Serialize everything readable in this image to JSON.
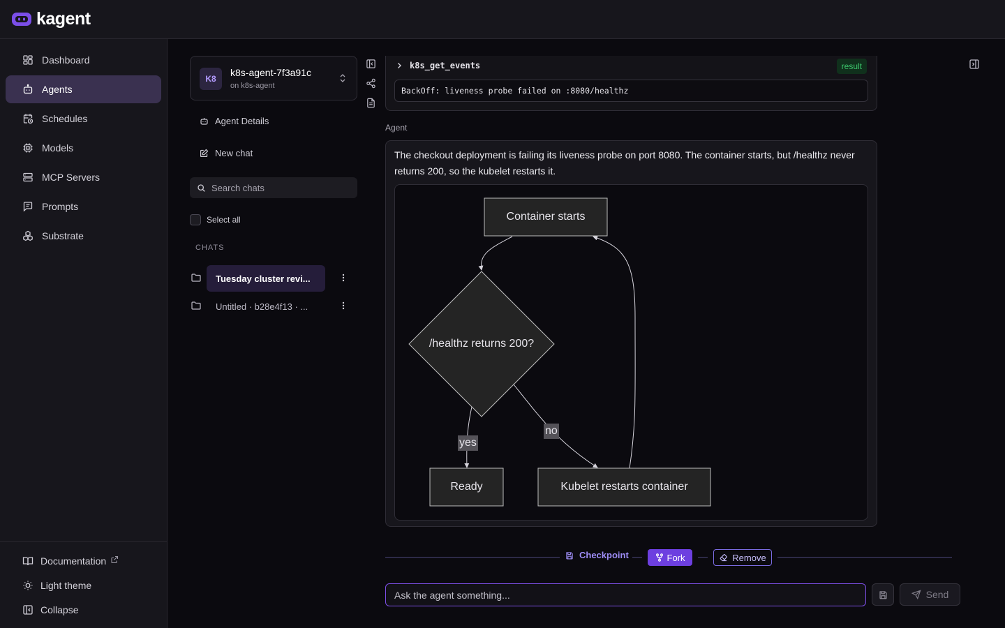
{
  "app": {
    "name": "kagent"
  },
  "sidebar": {
    "items": [
      {
        "label": "Dashboard",
        "icon": "dashboard-icon"
      },
      {
        "label": "Agents",
        "icon": "bot-icon",
        "active": true
      },
      {
        "label": "Schedules",
        "icon": "calendar-clock-icon"
      },
      {
        "label": "Models",
        "icon": "cpu-icon"
      },
      {
        "label": "MCP Servers",
        "icon": "server-icon"
      },
      {
        "label": "Prompts",
        "icon": "message-square-icon"
      },
      {
        "label": "Substrate",
        "icon": "boxes-icon"
      }
    ],
    "footer": {
      "documentation": "Documentation",
      "theme": "Light theme",
      "collapse": "Collapse"
    }
  },
  "agent": {
    "badge": "K8",
    "name": "k8s-agent-7f3a91c",
    "sub": "on k8s-agent"
  },
  "panel": {
    "agent_details": "Agent Details",
    "new_chat": "New chat",
    "search_placeholder": "Search chats",
    "select_all": "Select all",
    "chats_heading": "CHATS",
    "chats": [
      {
        "title": "Tuesday cluster revi...",
        "active": true
      },
      {
        "title": "Untitled · b28e4f13 · ...",
        "active": false
      }
    ]
  },
  "tool_call": {
    "name": "k8s_get_events",
    "badge": "result",
    "output": "BackOff: liveness probe failed on :8080/healthz"
  },
  "message": {
    "role": "Agent",
    "text": "The checkout deployment is failing its liveness probe on port 8080. The container starts, but /healthz never returns 200, so the kubelet restarts it.",
    "diagram": {
      "nodes": {
        "start": "Container starts",
        "decision": "/healthz returns 200?",
        "ready": "Ready",
        "restart": "Kubelet restarts container"
      },
      "edges": {
        "yes": "yes",
        "no": "no"
      }
    }
  },
  "checkpoint": {
    "label": "Checkpoint",
    "fork": "Fork",
    "remove": "Remove"
  },
  "composer": {
    "placeholder": "Ask the agent something...",
    "send": "Send"
  },
  "colors": {
    "accent": "#6d3fe0",
    "background": "#0b0a0f",
    "panel": "#17161c",
    "success": "#3cc46b"
  }
}
